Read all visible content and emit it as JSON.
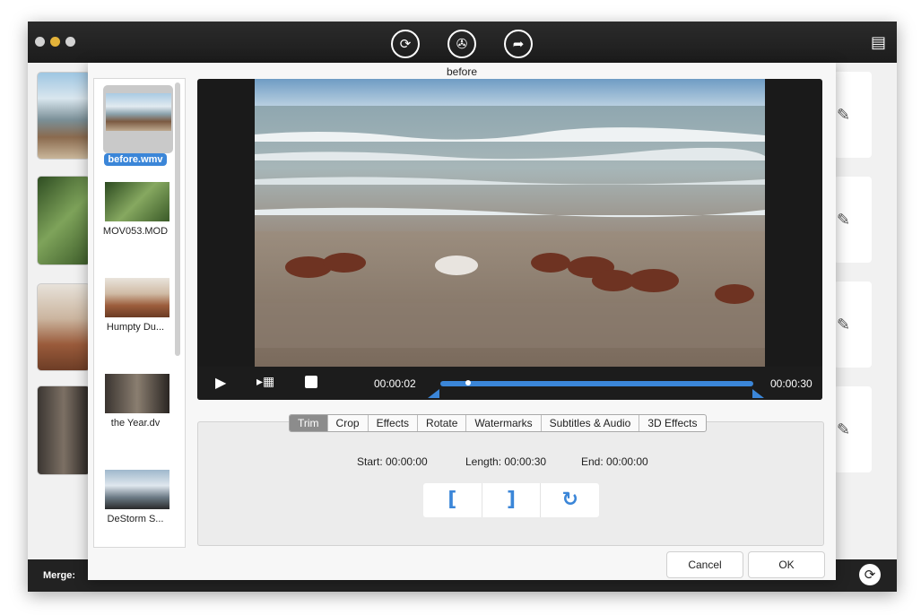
{
  "toolbar": {
    "icons": [
      "convert-icon",
      "media-icon",
      "share-icon",
      "toolbox-icon"
    ]
  },
  "dialog": {
    "title": "before",
    "files": [
      {
        "name": "before.wmv",
        "selected": true
      },
      {
        "name": "MOV053.MOD",
        "selected": false
      },
      {
        "name": "Humpty Du...",
        "selected": false
      },
      {
        "name": "the Year.dv",
        "selected": false
      },
      {
        "name": "DeStorm S...",
        "selected": false
      }
    ],
    "player": {
      "current_time": "00:00:02",
      "total_time": "00:00:30",
      "progress": 0.08
    },
    "tabs": [
      "Trim",
      "Crop",
      "Effects",
      "Rotate",
      "Watermarks",
      "Subtitles & Audio",
      "3D Effects"
    ],
    "active_tab": "Trim",
    "trim": {
      "start": "Start: 00:00:00",
      "length": "Length: 00:00:30",
      "end": "End: 00:00:00",
      "set_start": "[",
      "set_end": "]",
      "reset": "↻"
    },
    "buttons": {
      "cancel": "Cancel",
      "ok": "OK"
    }
  },
  "main": {
    "merge_label": "Merge:"
  },
  "colors": {
    "accent": "#3b86d8",
    "titlebar": "#222222"
  }
}
